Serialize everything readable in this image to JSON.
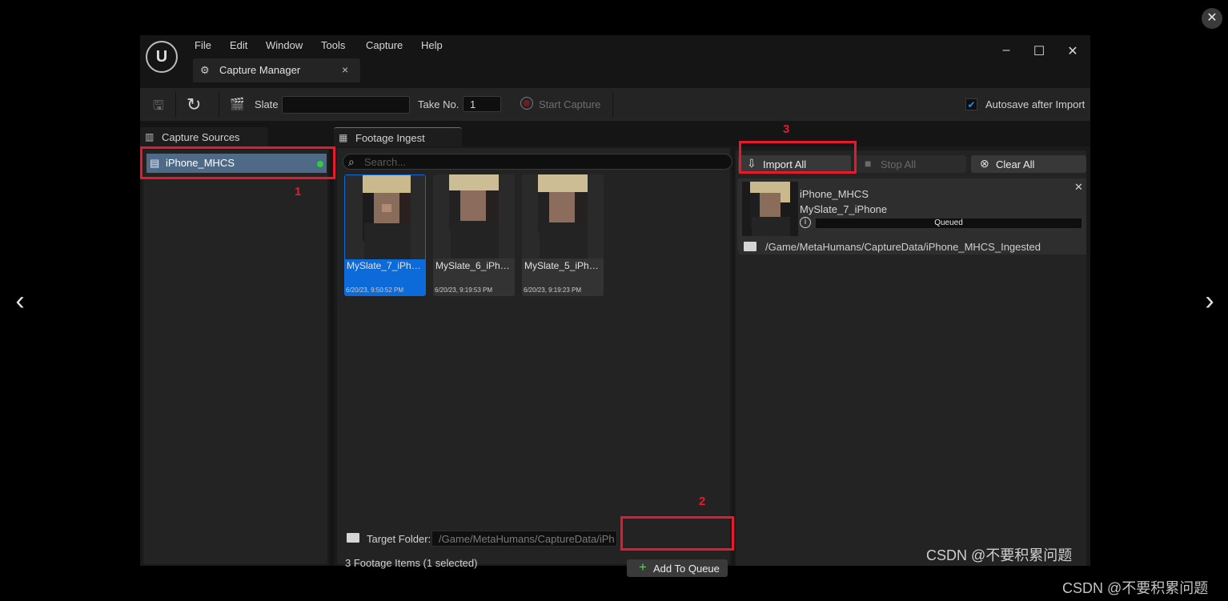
{
  "overlay": {
    "close_icon": "close-icon",
    "prev_icon": "chevron-left-icon",
    "next_icon": "chevron-right-icon"
  },
  "app": {
    "logo": "unreal-engine-logo",
    "menu": [
      "File",
      "Edit",
      "Window",
      "Tools",
      "Capture",
      "Help"
    ],
    "tab": {
      "label": "Capture Manager",
      "close": "×"
    }
  },
  "toolbar": {
    "slate_label": "Slate",
    "slate_value": "",
    "take_label": "Take No.",
    "take_value": "1",
    "start_capture": "Start Capture",
    "autosave_label": "Autosave after Import",
    "autosave_checked": true
  },
  "capture_sources": {
    "tab_label": "Capture Sources",
    "items": [
      {
        "label": "iPhone_MHCS",
        "status_color": "#2ecc40"
      }
    ]
  },
  "footage_ingest": {
    "tab_label": "Footage Ingest",
    "search_placeholder": "Search...",
    "items": [
      {
        "name": "MySlate_7_iPho...",
        "date": "6/20/23, 9:50:52 PM",
        "selected": true
      },
      {
        "name": "MySlate_6_iPho...",
        "date": "6/20/23, 9:19:53 PM",
        "selected": false
      },
      {
        "name": "MySlate_5_iPho...",
        "date": "6/20/23, 9:19:23 PM",
        "selected": false
      }
    ],
    "target_folder_label": "Target Folder:",
    "target_folder_value": "/Game/MetaHumans/CaptureData/iPh",
    "add_to_queue": "Add To Queue",
    "status": "3 Footage Items (1 selected)"
  },
  "queue": {
    "import_all": "Import All",
    "stop_all": "Stop All",
    "clear_all": "Clear All",
    "item": {
      "source": "iPhone_MHCS",
      "take": "MySlate_7_iPhone",
      "status": "Queued",
      "path": "/Game/MetaHumans/CaptureData/iPhone_MHCS_Ingested"
    }
  },
  "annotations": {
    "num1": "1",
    "num2": "2",
    "num3": "3",
    "color": "#e8192c"
  },
  "watermark": "CSDN @不要积累问题",
  "colors": {
    "accent": "#0c6bd8",
    "selected_source": "#4f6a86",
    "status_green": "#2ecc40"
  }
}
